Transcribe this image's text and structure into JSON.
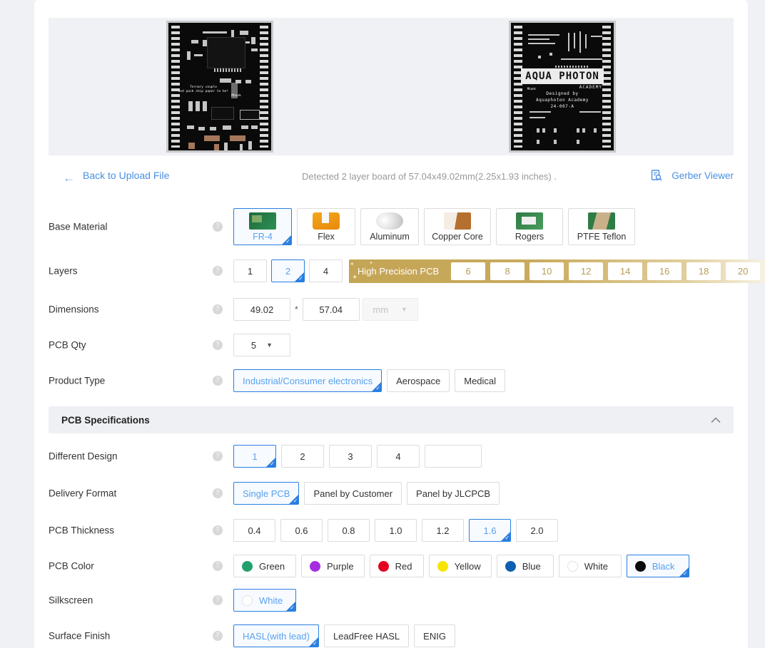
{
  "nav": {
    "back_label": "Back to Upload File",
    "back_icon": "arrow-left-icon",
    "detected_text": "Detected 2 layer board of 57.04x49.02mm(2.25x1.93 inches) .",
    "gerber_label": "Gerber Viewer",
    "gerber_icon": "document-search-icon"
  },
  "preview": {
    "top_layer": {
      "silk_line1": "Ternary couple",
      "silk_line2": "and pack ship paper to be!",
      "silk_mark": "Mbank"
    },
    "bottom_layer": {
      "logo": "AQUA PHOTON",
      "logo_sub": "ACADEMY",
      "line1": "Designed by",
      "line2": "Aquaphoton Academy",
      "line3": "24-007-A",
      "corner_mark": "Mbank"
    }
  },
  "rows": {
    "base_material": {
      "label": "Base Material",
      "options": [
        {
          "label": "FR-4",
          "swatch": "fr4-swatch",
          "selected": true
        },
        {
          "label": "Flex",
          "swatch": "flex-swatch",
          "selected": false
        },
        {
          "label": "Aluminum",
          "swatch": "aluminum-swatch",
          "selected": false
        },
        {
          "label": "Copper Core",
          "swatch": "copper-core-swatch",
          "selected": false
        },
        {
          "label": "Rogers",
          "swatch": "rogers-swatch",
          "selected": false
        },
        {
          "label": "PTFE Teflon",
          "swatch": "ptfe-teflon-swatch",
          "selected": false
        }
      ]
    },
    "layers": {
      "label": "Layers",
      "options": [
        {
          "label": "1",
          "selected": false
        },
        {
          "label": "2",
          "selected": true
        },
        {
          "label": "4",
          "selected": false
        }
      ],
      "high_precision": {
        "title": "High Precision PCB",
        "options": [
          "6",
          "8",
          "10",
          "12",
          "14",
          "16",
          "18",
          "20"
        ]
      }
    },
    "dimensions": {
      "label": "Dimensions",
      "width_value": "49.02",
      "separator": "*",
      "length_value": "57.04",
      "unit_value": "mm"
    },
    "pcb_qty": {
      "label": "PCB Qty",
      "value": "5"
    },
    "product_type": {
      "label": "Product Type",
      "options": [
        {
          "label": "Industrial/Consumer electronics",
          "selected": true
        },
        {
          "label": "Aerospace",
          "selected": false
        },
        {
          "label": "Medical",
          "selected": false
        }
      ]
    }
  },
  "section": {
    "title": "PCB Specifications",
    "collapse_icon": "chevron-up-icon"
  },
  "specs": {
    "different_design": {
      "label": "Different Design",
      "options": [
        {
          "label": "1",
          "selected": true
        },
        {
          "label": "2",
          "selected": false
        },
        {
          "label": "3",
          "selected": false
        },
        {
          "label": "4",
          "selected": false
        }
      ],
      "custom_value": "",
      "custom_placeholder": ""
    },
    "delivery_format": {
      "label": "Delivery Format",
      "options": [
        {
          "label": "Single PCB",
          "selected": true
        },
        {
          "label": "Panel by Customer",
          "selected": false
        },
        {
          "label": "Panel by JLCPCB",
          "selected": false
        }
      ]
    },
    "pcb_thickness": {
      "label": "PCB Thickness",
      "options": [
        {
          "label": "0.4",
          "selected": false
        },
        {
          "label": "0.6",
          "selected": false
        },
        {
          "label": "0.8",
          "selected": false
        },
        {
          "label": "1.0",
          "selected": false
        },
        {
          "label": "1.2",
          "selected": false
        },
        {
          "label": "1.6",
          "selected": true
        },
        {
          "label": "2.0",
          "selected": false
        }
      ]
    },
    "pcb_color": {
      "label": "PCB Color",
      "options": [
        {
          "label": "Green",
          "color": "#22a06b",
          "selected": false
        },
        {
          "label": "Purple",
          "color": "#a42ee0",
          "selected": false
        },
        {
          "label": "Red",
          "color": "#e60020",
          "selected": false
        },
        {
          "label": "Yellow",
          "color": "#f5e500",
          "selected": false
        },
        {
          "label": "Blue",
          "color": "#0d5fb0",
          "selected": false
        },
        {
          "label": "White",
          "color": "#ffffff",
          "selected": false
        },
        {
          "label": "Black",
          "color": "#0a0a0a",
          "selected": true
        }
      ]
    },
    "silkscreen": {
      "label": "Silkscreen",
      "options": [
        {
          "label": "White",
          "color": "#ffffff",
          "selected": true
        }
      ]
    },
    "surface_finish": {
      "label": "Surface Finish",
      "options": [
        {
          "label": "HASL(with lead)",
          "selected": true
        },
        {
          "label": "LeadFree HASL",
          "selected": false
        },
        {
          "label": "ENIG",
          "selected": false
        }
      ]
    }
  },
  "colors": {
    "accent": "#2a7fe0",
    "link": "#4a90e2",
    "gold": "#c4a555",
    "page_bg": "#f0f1f5"
  }
}
